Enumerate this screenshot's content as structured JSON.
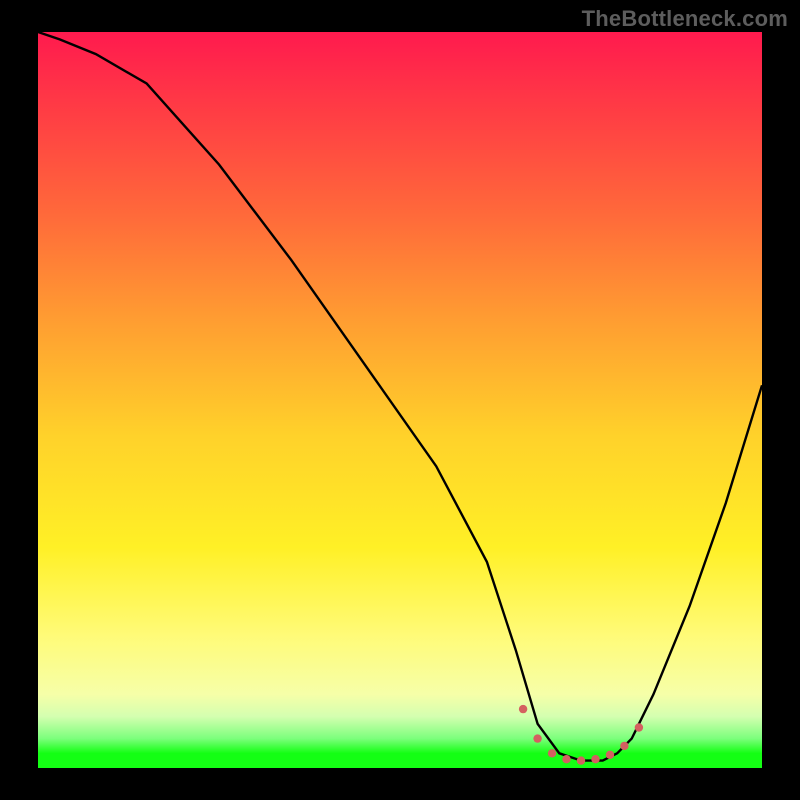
{
  "watermark": "TheBottleneck.com",
  "chart_data": {
    "type": "line",
    "title": "",
    "xlabel": "",
    "ylabel": "",
    "xlim": [
      0,
      100
    ],
    "ylim": [
      0,
      100
    ],
    "grid": false,
    "legend": false,
    "description": "Single black curve over vertical rainbow gradient (red top → green bottom). Curve starts near top-left, descends steeply to a broad flat bottleneck minimum with small red marker dots around x≈69–82, then rises again toward the right edge.",
    "series": [
      {
        "name": "curve",
        "color": "#000000",
        "x": [
          0,
          3,
          8,
          15,
          25,
          35,
          45,
          55,
          62,
          66,
          69,
          72,
          75,
          78,
          80,
          82,
          85,
          90,
          95,
          100
        ],
        "values": [
          100,
          99,
          97,
          93,
          82,
          69,
          55,
          41,
          28,
          16,
          6,
          2,
          1,
          1,
          2,
          4,
          10,
          22,
          36,
          52
        ]
      }
    ],
    "markers": {
      "name": "bottleneck-dots",
      "color": "#d46060",
      "x": [
        67,
        69,
        71,
        73,
        75,
        77,
        79,
        81,
        83
      ],
      "values": [
        8,
        4,
        2,
        1.2,
        1.0,
        1.2,
        1.8,
        3,
        5.5
      ]
    }
  }
}
